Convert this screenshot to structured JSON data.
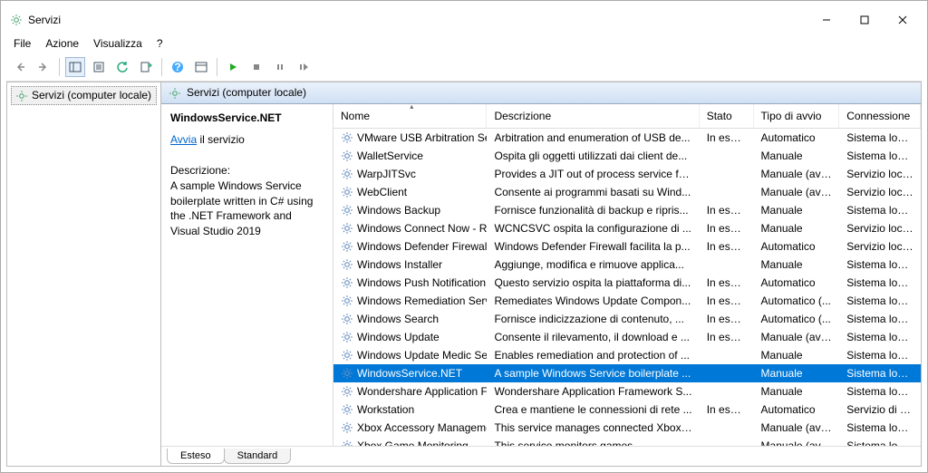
{
  "window": {
    "title": "Servizi"
  },
  "menu": {
    "file": "File",
    "action": "Azione",
    "view": "Visualizza",
    "help": "?"
  },
  "tree": {
    "root": "Servizi (computer locale)"
  },
  "header": {
    "title": "Servizi (computer locale)"
  },
  "detail": {
    "selected_name": "WindowsService.NET",
    "action_link": "Avvia",
    "action_suffix": " il servizio",
    "desc_label": "Descrizione:",
    "desc_text": "A sample Windows Service boilerplate written in C# using the .NET Framework and Visual Studio 2019"
  },
  "columns": {
    "name": "Nome",
    "desc": "Descrizione",
    "state": "Stato",
    "start": "Tipo di avvio",
    "logon": "Connessione"
  },
  "tabs": {
    "extended": "Esteso",
    "standard": "Standard"
  },
  "services": [
    {
      "name": "VMware USB Arbitration Ser...",
      "desc": "Arbitration and enumeration of USB de...",
      "state": "In esec...",
      "start": "Automatico",
      "logon": "Sistema locale",
      "selected": false
    },
    {
      "name": "WalletService",
      "desc": "Ospita gli oggetti utilizzati dai client de...",
      "state": "",
      "start": "Manuale",
      "logon": "Sistema locale",
      "selected": false
    },
    {
      "name": "WarpJITSvc",
      "desc": "Provides a JIT out of process service fo...",
      "state": "",
      "start": "Manuale (avv...",
      "logon": "Servizio locale",
      "selected": false
    },
    {
      "name": "WebClient",
      "desc": "Consente ai programmi basati su Wind...",
      "state": "",
      "start": "Manuale (avv...",
      "logon": "Servizio locale",
      "selected": false
    },
    {
      "name": "Windows Backup",
      "desc": "Fornisce funzionalità di backup e ripris...",
      "state": "In esec...",
      "start": "Manuale",
      "logon": "Sistema locale",
      "selected": false
    },
    {
      "name": "Windows Connect Now - R...",
      "desc": "WCNCSVC ospita la configurazione di ...",
      "state": "In esec...",
      "start": "Manuale",
      "logon": "Servizio locale",
      "selected": false
    },
    {
      "name": "Windows Defender Firewall",
      "desc": "Windows Defender Firewall facilita la p...",
      "state": "In esec...",
      "start": "Automatico",
      "logon": "Servizio locale",
      "selected": false
    },
    {
      "name": "Windows Installer",
      "desc": "Aggiunge, modifica e rimuove applica...",
      "state": "",
      "start": "Manuale",
      "logon": "Sistema locale",
      "selected": false
    },
    {
      "name": "Windows Push Notification...",
      "desc": "Questo servizio ospita la piattaforma di...",
      "state": "In esec...",
      "start": "Automatico",
      "logon": "Sistema locale",
      "selected": false
    },
    {
      "name": "Windows Remediation Servi...",
      "desc": "Remediates Windows Update Compon...",
      "state": "In esec...",
      "start": "Automatico (...",
      "logon": "Sistema locale",
      "selected": false
    },
    {
      "name": "Windows Search",
      "desc": "Fornisce indicizzazione di contenuto, ...",
      "state": "In esec...",
      "start": "Automatico (...",
      "logon": "Sistema locale",
      "selected": false
    },
    {
      "name": "Windows Update",
      "desc": "Consente il rilevamento, il download e ...",
      "state": "In esec...",
      "start": "Manuale (avv...",
      "logon": "Sistema locale",
      "selected": false
    },
    {
      "name": "Windows Update Medic Ser...",
      "desc": "Enables remediation and protection of ...",
      "state": "",
      "start": "Manuale",
      "logon": "Sistema locale",
      "selected": false
    },
    {
      "name": "WindowsService.NET",
      "desc": "A sample Windows Service boilerplate ...",
      "state": "",
      "start": "Manuale",
      "logon": "Sistema locale",
      "selected": true
    },
    {
      "name": "Wondershare Application Fr...",
      "desc": "Wondershare Application Framework S...",
      "state": "",
      "start": "Manuale",
      "logon": "Sistema locale",
      "selected": false
    },
    {
      "name": "Workstation",
      "desc": "Crea e mantiene le connessioni di rete ...",
      "state": "In esec...",
      "start": "Automatico",
      "logon": "Servizio di rete",
      "selected": false
    },
    {
      "name": "Xbox Accessory Manageme...",
      "desc": "This service manages connected Xbox ...",
      "state": "",
      "start": "Manuale (avv...",
      "logon": "Sistema locale",
      "selected": false
    },
    {
      "name": "Xbox Game Monitoring",
      "desc": "This service monitors games.",
      "state": "",
      "start": "Manuale (avv...",
      "logon": "Sistema locale",
      "selected": false
    }
  ]
}
